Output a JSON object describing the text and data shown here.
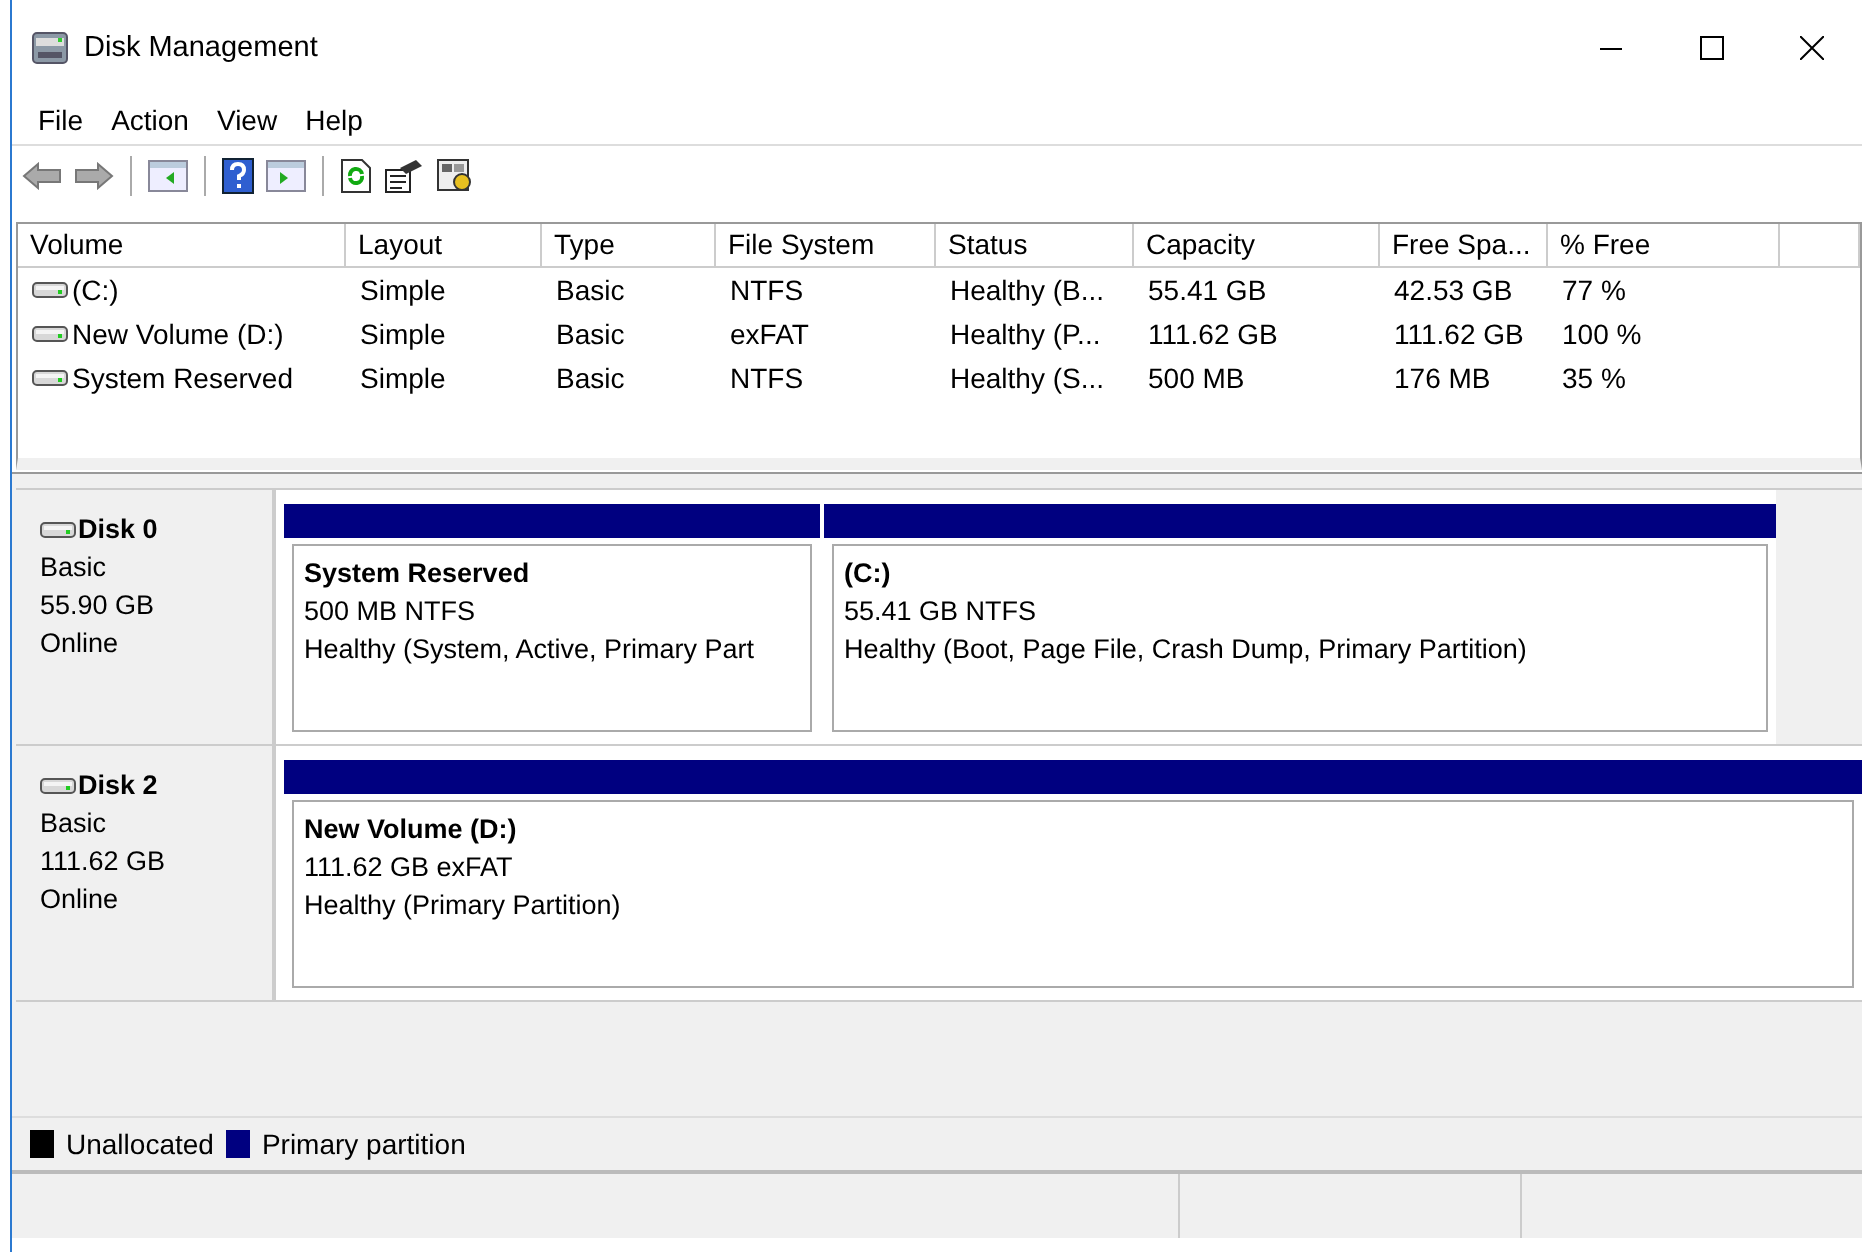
{
  "window": {
    "title": "Disk Management"
  },
  "menu": [
    "File",
    "Action",
    "View",
    "Help"
  ],
  "volume_table": {
    "columns": [
      "Volume",
      "Layout",
      "Type",
      "File System",
      "Status",
      "Capacity",
      "Free Spa...",
      "% Free"
    ],
    "rows": [
      {
        "cells": [
          "(C:)",
          "Simple",
          "Basic",
          "NTFS",
          "Healthy (B...",
          "55.41 GB",
          "42.53 GB",
          "77 %"
        ]
      },
      {
        "cells": [
          "New Volume (D:)",
          "Simple",
          "Basic",
          "exFAT",
          "Healthy (P...",
          "111.62 GB",
          "111.62 GB",
          "100 %"
        ]
      },
      {
        "cells": [
          "System Reserved",
          "Simple",
          "Basic",
          "NTFS",
          "Healthy (S...",
          "500 MB",
          "176 MB",
          "35 %"
        ]
      }
    ]
  },
  "disks": [
    {
      "name": "Disk 0",
      "type": "Basic",
      "size": "55.90 GB",
      "status": "Online",
      "partitions": [
        {
          "kind": "primary",
          "name": "System Reserved",
          "size": "500 MB NTFS",
          "status": "Healthy (System, Active, Primary Part"
        },
        {
          "kind": "primary",
          "name": "(C:)",
          "size": "55.41 GB NTFS",
          "status": "Healthy (Boot, Page File, Crash Dump, Primary Partition)"
        }
      ]
    },
    {
      "name": "Disk 2",
      "type": "Basic",
      "size": "111.62 GB",
      "status": "Online",
      "partitions": [
        {
          "kind": "primary",
          "name": "New Volume  (D:)",
          "size": "111.62 GB exFAT",
          "status": "Healthy (Primary Partition)"
        }
      ]
    }
  ],
  "legend": [
    {
      "label": "Unallocated",
      "color": "#000000"
    },
    {
      "label": "Primary partition",
      "color": "#000080"
    }
  ]
}
